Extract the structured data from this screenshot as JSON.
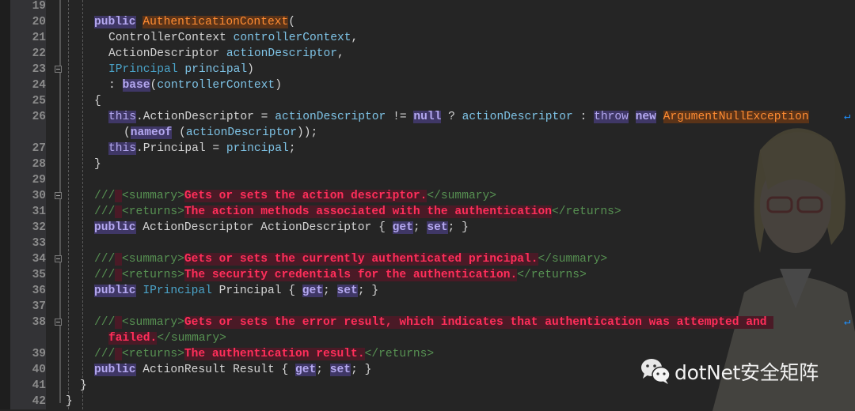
{
  "editor": {
    "lines": [
      {
        "num": "19"
      },
      {
        "num": "20"
      },
      {
        "num": "21"
      },
      {
        "num": "22"
      },
      {
        "num": "23"
      },
      {
        "num": "24"
      },
      {
        "num": "25"
      },
      {
        "num": "26"
      },
      {
        "num": ""
      },
      {
        "num": "27"
      },
      {
        "num": "28"
      },
      {
        "num": "29"
      },
      {
        "num": "30"
      },
      {
        "num": "31"
      },
      {
        "num": "32"
      },
      {
        "num": "33"
      },
      {
        "num": "34"
      },
      {
        "num": "35"
      },
      {
        "num": "36"
      },
      {
        "num": "37"
      },
      {
        "num": "38"
      },
      {
        "num": ""
      },
      {
        "num": "39"
      },
      {
        "num": "40"
      },
      {
        "num": "41"
      },
      {
        "num": "42"
      }
    ],
    "tokens": {
      "public": "public",
      "authCtx": "AuthenticationContext",
      "paren_open": "(",
      "l21_type": "ControllerContext",
      "l21_param": "controllerContext",
      "comma": ",",
      "l22_type": "ActionDescriptor",
      "l22_param": "actionDescriptor",
      "l23_type": "IPrincipal",
      "l23_param": "principal",
      "paren_close": ")",
      "colon": ": ",
      "base": "base",
      "l24_arg": "controllerContext",
      "brace_open": "{",
      "brace_close": "}",
      "this": "this",
      "l26_a": ".ActionDescriptor = ",
      "l26_b": "actionDescriptor",
      "l26_c": " != ",
      "null": "null",
      "l26_d": " ? ",
      "l26_e": "actionDescriptor",
      "l26_f": " : ",
      "throw": "throw",
      "new": "new",
      "argNull": "ArgumentNullException",
      "l26w_a": "(",
      "nameof": "nameof",
      "l26w_b": " (",
      "l26w_c": "actionDescriptor",
      "l26w_d": "));",
      "l27_a": ".Principal = ",
      "l27_b": "principal",
      "semi": ";",
      "slashes": "///",
      "summary_open": "<summary>",
      "summary_close": "</summary>",
      "returns_open": "<returns>",
      "returns_close": "</returns>",
      "l30_doc": "Gets or sets the action descriptor.",
      "l31_doc": "The action methods associated with the authentication",
      "l32_a": " ActionDescriptor ActionDescriptor { ",
      "get": "get",
      "set": "set",
      "semi_sp": "; ",
      "close_prop": "; }",
      "l34_doc": "Gets or sets the currently authenticated principal.",
      "l35_doc": "The security credentials for the authentication.",
      "l36_type": "IPrincipal",
      "l36_a": " Principal { ",
      "l38_doc": "Gets or sets the error result, which indicates that authentication was attempted and ",
      "l38w_doc": "failed.",
      "l39_doc": "The authentication result.",
      "l40_a": " ActionResult Result { ",
      "wrap_glyph": "↵"
    }
  },
  "watermark": {
    "text": "dotNet安全矩阵",
    "icon": "wechat-icon"
  },
  "colors": {
    "background": "#252525",
    "keyword": "#b4a8f0",
    "class": "#ff8c32",
    "identifier": "#7ec3e6",
    "comment": "#579152",
    "doc_text": "#ff2e5a"
  }
}
